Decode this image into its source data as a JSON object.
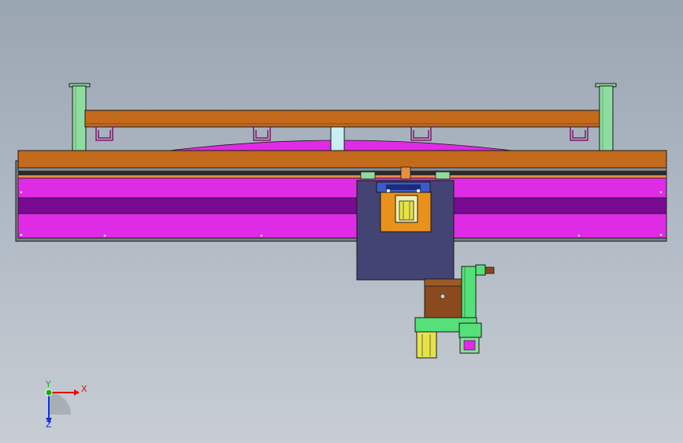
{
  "viewport": {
    "background_top": "#9aa5b2",
    "background_bottom": "#c7cdd3"
  },
  "colors": {
    "beam_orange": "#c36a1c",
    "column_green": "#8fdca0",
    "panel_magenta": "#e02be6",
    "panel_purple": "#7a0a92",
    "carriage_navy": "#434374",
    "block_orange": "#e8921d",
    "bracket_green": "#55e07a",
    "motor_yellow": "#e6e34a",
    "rail_blue": "#3b5bc8",
    "edge": "#1a1a1a"
  },
  "triad": {
    "x_label": "X",
    "y_label": "Y",
    "z_label": "Z",
    "x_color": "#e01010",
    "y_color": "#10b010",
    "z_color": "#1030e0"
  }
}
